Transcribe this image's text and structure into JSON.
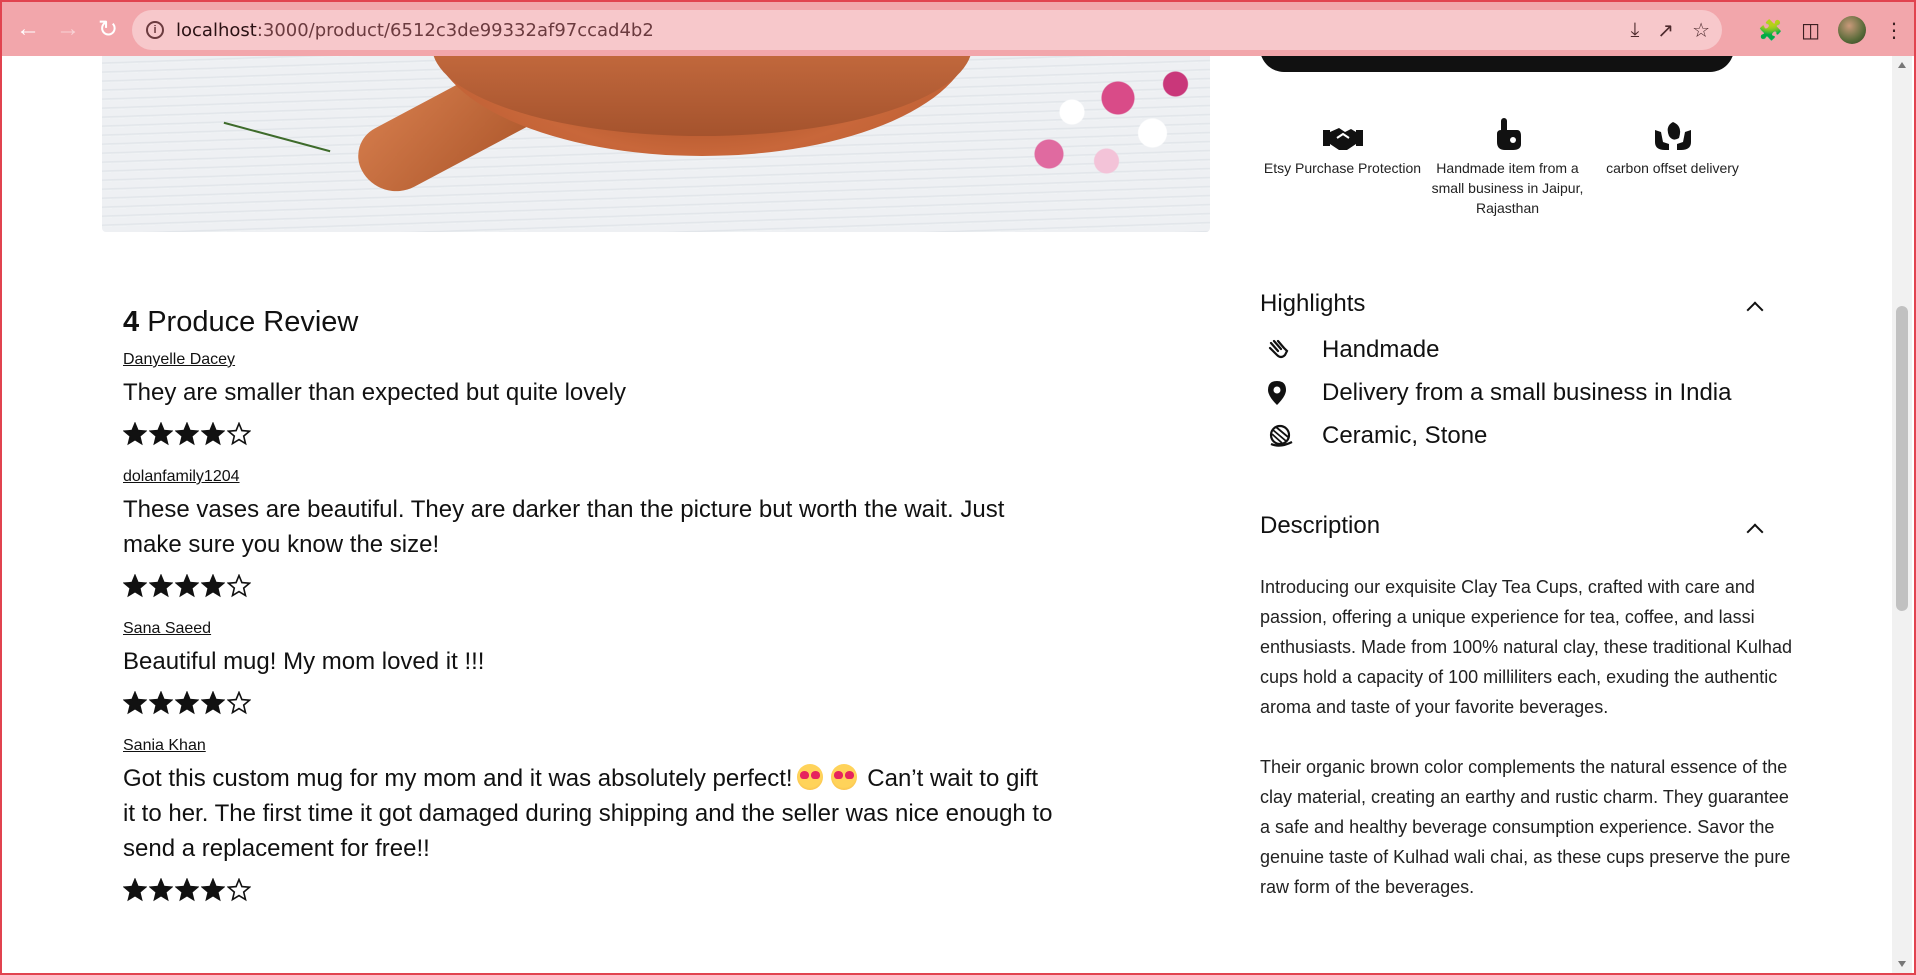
{
  "browser": {
    "url_host": "localhost",
    "url_path": ":3000/product/6512c3de99332af97ccad4b2",
    "colors": {
      "frame": "#f2a6ab",
      "omnibox": "#f7c8cb",
      "accent": "#e1434f"
    }
  },
  "badges": [
    {
      "icon": "handshake-icon",
      "label": "Etsy Purchase Protection"
    },
    {
      "icon": "hand-made-icon",
      "label": "Handmade item from a small business in Jaipur, Rajasthan"
    },
    {
      "icon": "leaf-hands-icon",
      "label": "carbon offset delivery"
    }
  ],
  "highlights": {
    "title": "Highlights",
    "items": [
      {
        "icon": "hand-wave-icon",
        "label": "Handmade"
      },
      {
        "icon": "location-pin-icon",
        "label": "Delivery from a small business in India"
      },
      {
        "icon": "material-icon",
        "label": "Ceramic, Stone"
      }
    ]
  },
  "description": {
    "title": "Description",
    "paragraphs": [
      "Introducing our exquisite Clay Tea Cups, crafted with care and passion, offering a unique experience for tea, coffee, and lassi enthusiasts. Made from 100% natural clay, these traditional Kulhad cups hold a capacity of 100 milliliters each, exuding the authentic aroma and taste of your favorite beverages.",
      "Their organic brown color complements the natural essence of the clay material, creating an earthy and rustic charm. They guarantee a safe and healthy beverage consumption experience. Savor the genuine taste of Kulhad wali chai, as these cups preserve the pure raw form of the beverages."
    ]
  },
  "reviews": {
    "count": "4",
    "heading": "Produce Review",
    "items": [
      {
        "author": "Danyelle Dacey",
        "text": "They are smaller than expected but quite lovely",
        "rating": 4
      },
      {
        "author": "dolanfamily1204",
        "text": "These vases are beautiful. They are darker than the picture but worth the wait. Just make sure you know the size!",
        "rating": 4
      },
      {
        "author": "Sana Saeed",
        "text": "Beautiful mug! My mom loved it !!!",
        "rating": 4
      },
      {
        "author": "Sania Khan",
        "text_before": "Got this custom mug for my mom and it was absolutely perfect!",
        "text_after": " Can’t wait to gift it to her. The first time it got damaged during shipping and the seller was nice enough to send a replacement for free!!",
        "rating": 4
      }
    ]
  }
}
